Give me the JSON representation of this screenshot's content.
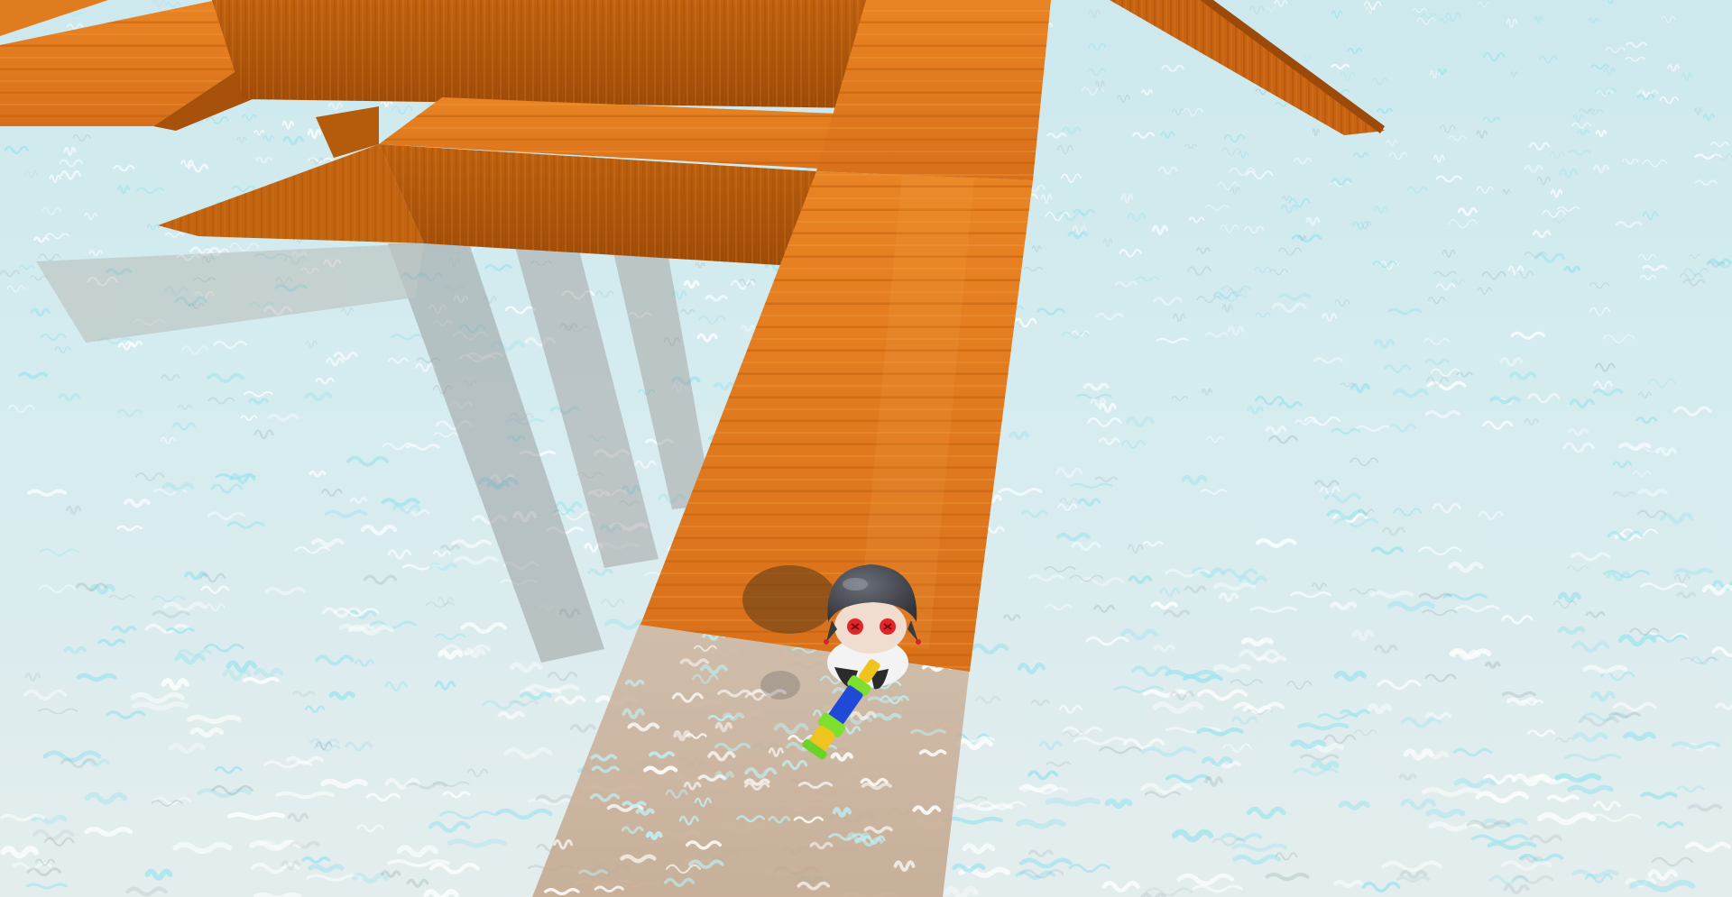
{
  "game": {
    "view": "third-person 3D",
    "hud_text": []
  },
  "colors": {
    "water_light": "#dff3f6",
    "water_mid": "#b9dfe6",
    "water_caustic": "#9fe3ee",
    "water_shadow": "#8aa0a8",
    "sand_underwater": "#c9b09a",
    "wood_top": "#e07a1e",
    "wood_top_light": "#f0922e",
    "wood_side": "#b85a10",
    "wood_side_dark": "#8f4108",
    "plank_line": "#c86612",
    "helmet": "#3d4047",
    "helmet_highlight": "#646972",
    "eyes": "#e0262a",
    "skin": "#f1ddd0",
    "shirt": "#f5f5f5",
    "water_gun_blue": "#1f49d6",
    "water_gun_green": "#7de02f",
    "water_gun_yellow": "#f0c41e"
  },
  "scene": {
    "objects": [
      "wooden-dock-walkway",
      "wooden-platform-upper",
      "wooden-ramp-right",
      "water-surface",
      "player-character",
      "water-gun"
    ]
  }
}
